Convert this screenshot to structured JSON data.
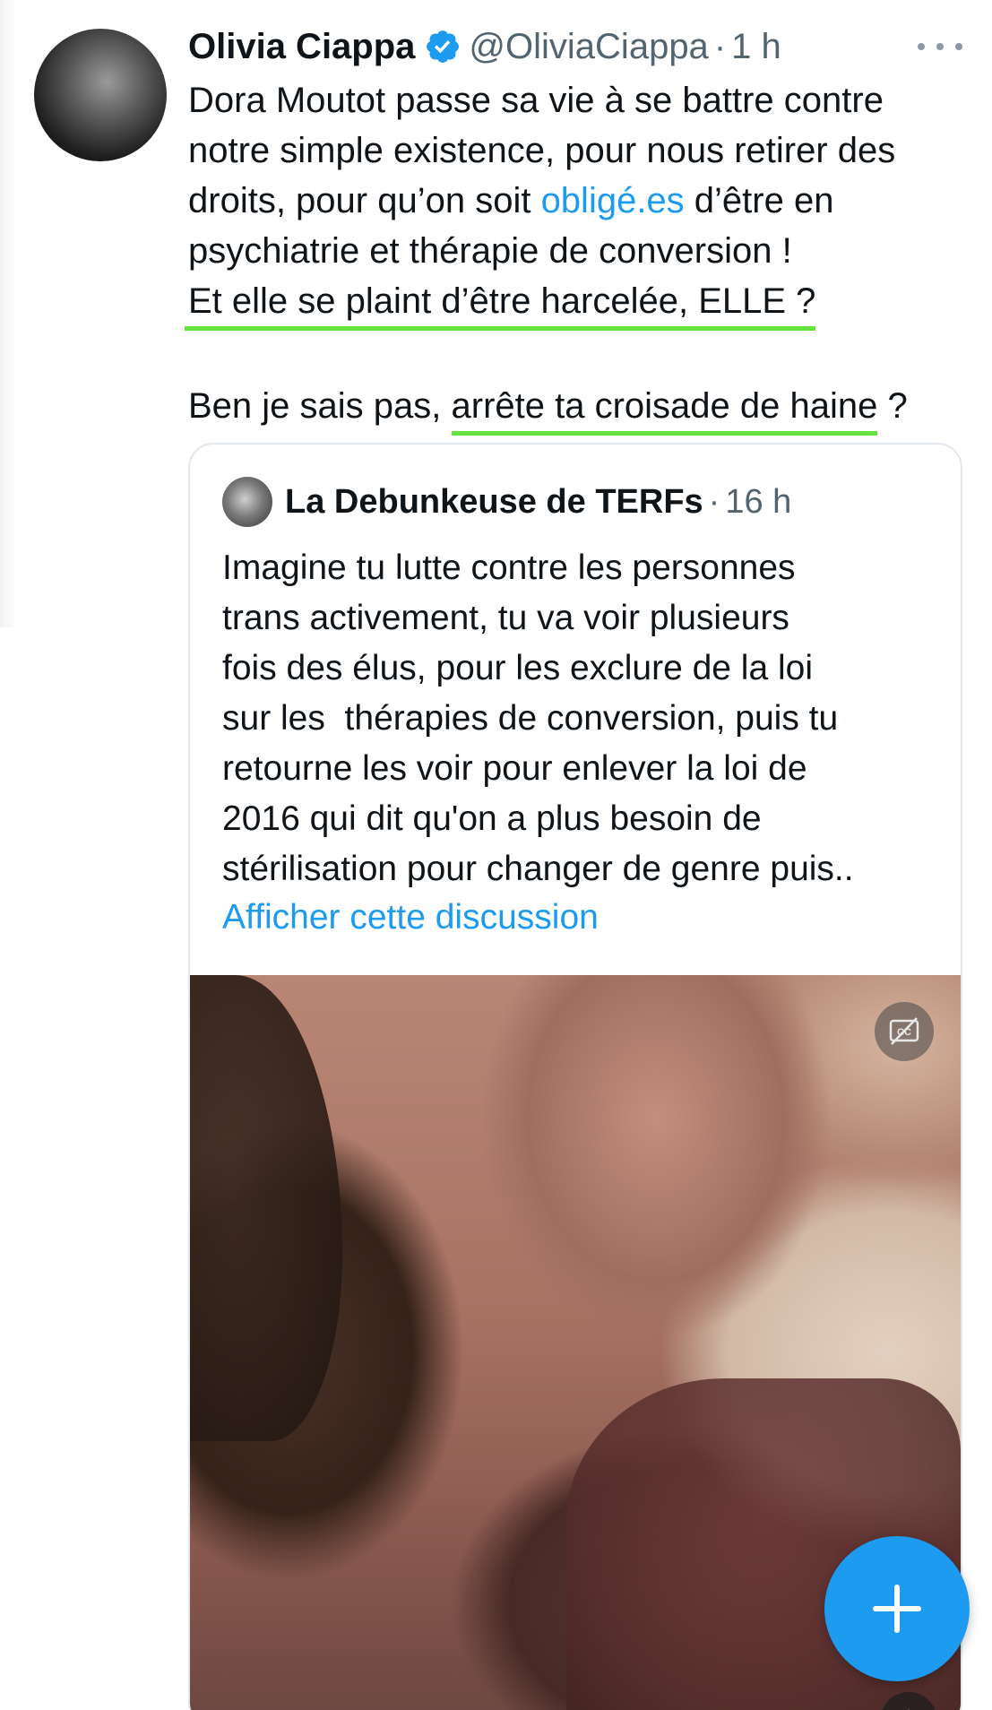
{
  "tweet": {
    "author_name": "Olivia Ciappa",
    "handle": "@OliviaCiappa",
    "separator": "·",
    "time": "1 h",
    "lines": {
      "l1": "Dora Moutot passe sa vie à se battre contre",
      "l2": "notre simple existence, pour nous retirer des",
      "l3_before": "droits, pour qu’on soit ",
      "l3_link": "obligé.es",
      "l3_after": " d’être en",
      "l4": "psychiatrie et thérapie de conversion !",
      "l5": "Et elle se plaint d’être harcelée, ELLE ?",
      "l6_before": "Ben je sais pas, ",
      "l6_highlight": "arrête ta croisade de haine",
      "l6_after": " ?"
    }
  },
  "quoted_tweet": {
    "author_name": "La Debunkeuse de TERFs",
    "separator": "·",
    "time": "16 h",
    "text": "Imagine tu lutte contre les personnes\ntrans activement, tu va voir plusieurs\nfois des élus, pour les exclure de la loi\nsur les  thérapies de conversion, puis tu\nretourne les voir pour enlever la loi de\n2016 qui dit qu'on a plus besoin de\nstérilisation pour changer de genre puis..",
    "show_thread_label": "Afficher cette discussion"
  },
  "icons": {
    "verified": "verified-badge-icon",
    "more": "more-options-icon",
    "captions": "closed-captions-off-icon",
    "mute": "speaker-muted-icon",
    "compose": "plus-icon"
  },
  "colors": {
    "accent": "#1d9bf0",
    "highlight_underline": "#64e33e",
    "secondary_text": "#536471"
  }
}
